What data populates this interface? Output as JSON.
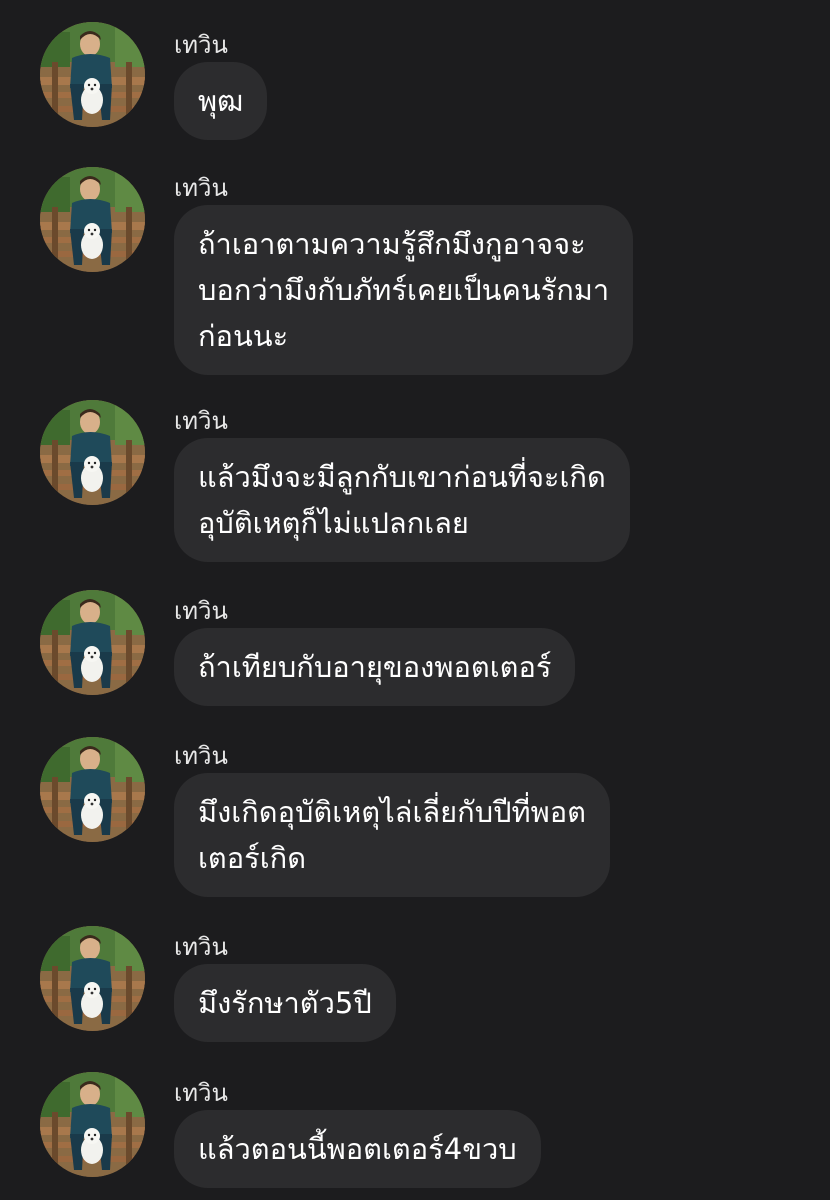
{
  "messages": [
    {
      "sender": "เทวิน",
      "text": "พุฒ"
    },
    {
      "sender": "เทวิน",
      "text": "ถ้าเอาตามความรู้สึกมึงกูอาจจะ\nบอกว่ามึงกับภัทร์เคยเป็นคนรักมา\nก่อนนะ"
    },
    {
      "sender": "เทวิน",
      "text": "แล้วมึงจะมีลูกกับเขาก่อนที่จะเกิด\nอุบัติเหตุก็ไม่แปลกเลย"
    },
    {
      "sender": "เทวิน",
      "text": "ถ้าเทียบกับอายุของพอตเตอร์"
    },
    {
      "sender": "เทวิน",
      "text": "มึงเกิดอุบัติเหตุไล่เลี่ยกับปีที่พอต\nเตอร์เกิด"
    },
    {
      "sender": "เทวิน",
      "text": "มึงรักษาตัว5ปี"
    },
    {
      "sender": "เทวิน",
      "text": "แล้วตอนนี้พอตเตอร์4ขวบ"
    }
  ],
  "colors": {
    "background": "#1c1c1e",
    "bubble": "#2c2c2e",
    "text": "#ffffff"
  },
  "icons": {
    "avatar": "profile-photo-man-with-white-dog"
  }
}
